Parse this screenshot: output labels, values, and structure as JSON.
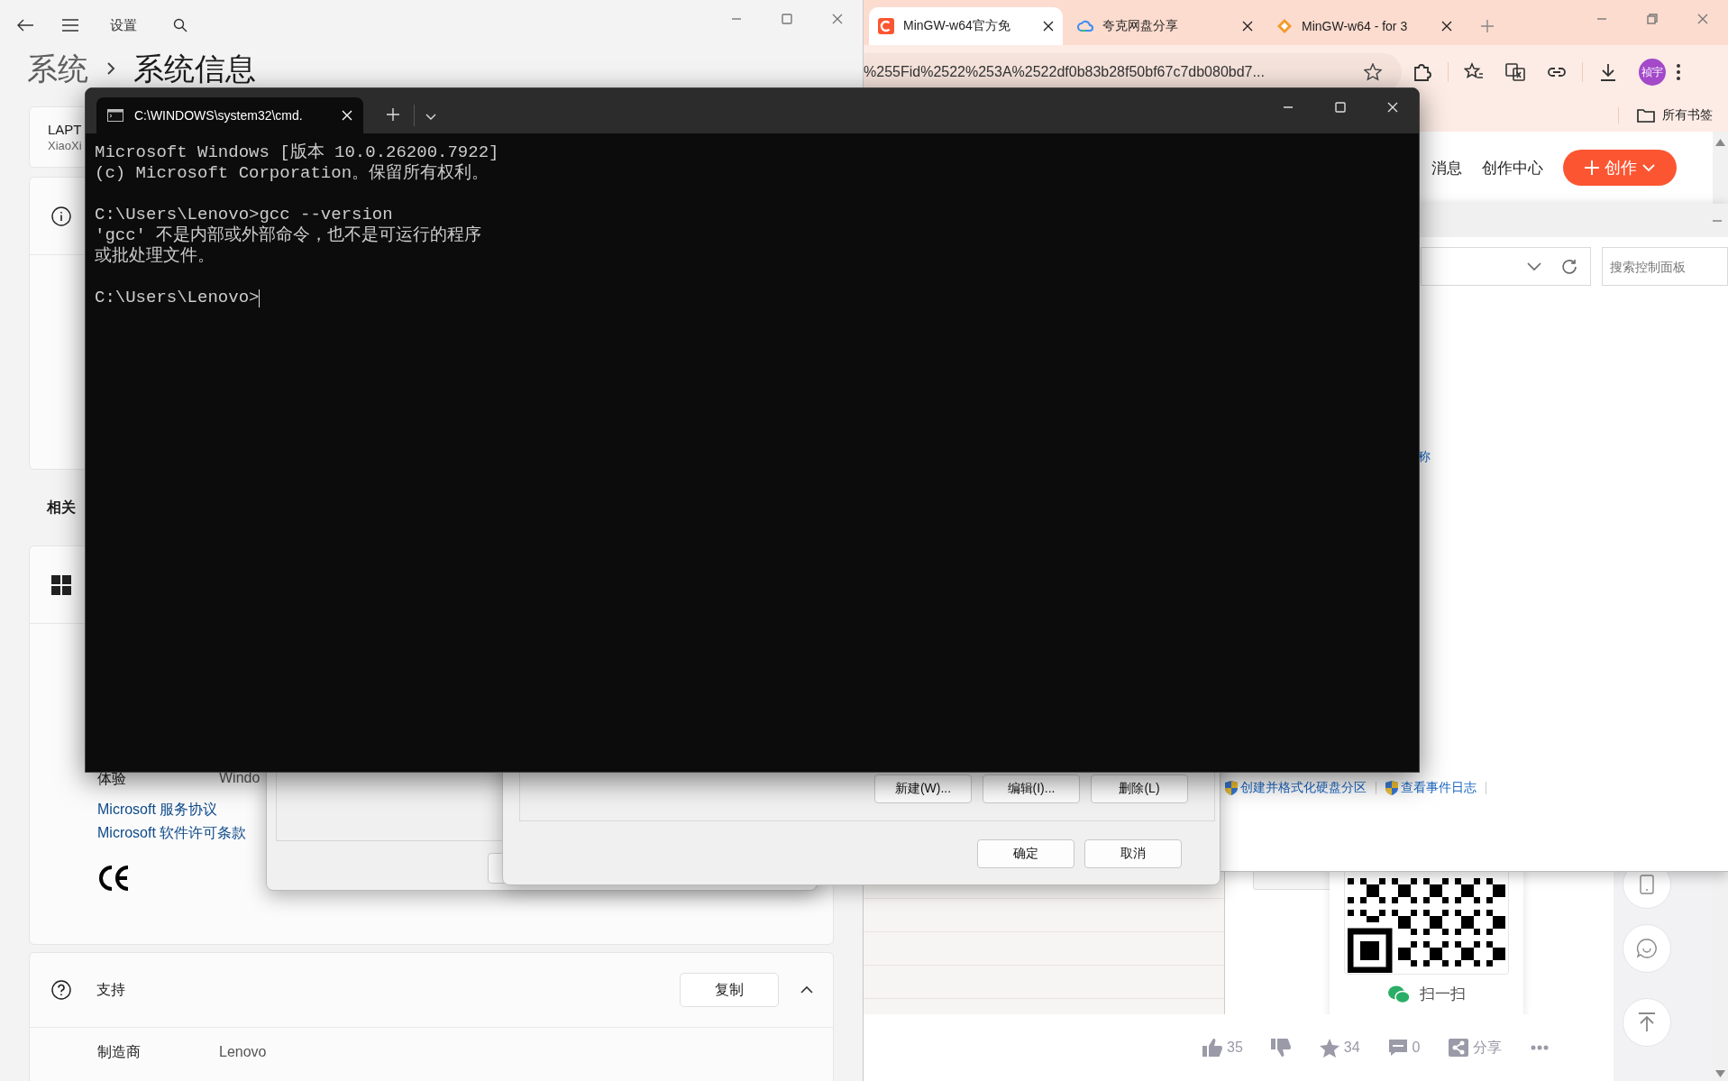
{
  "settings": {
    "title": "设置",
    "breadcrumb": {
      "parent": "系统",
      "current": "系统信息"
    },
    "device": {
      "name": "LAPT",
      "model": "XiaoXi"
    },
    "related_heading": "相关",
    "specs": [
      {
        "label": "体验",
        "value": "Windo"
      }
    ],
    "links": [
      "Microsoft 服务协议",
      "Microsoft 软件许可条款"
    ],
    "support": {
      "title": "支持",
      "copy_button": "复制",
      "expanded": true,
      "rows": [
        {
          "label": "制造商",
          "value": "Lenovo"
        }
      ]
    }
  },
  "browser": {
    "tabs": [
      {
        "title": "MinGW-w64官方免",
        "selected": true,
        "kind": "letter-c"
      },
      {
        "title": "夸克网盘分享",
        "selected": false,
        "kind": "cloud"
      },
      {
        "title": "MinGW-w64 - for 3",
        "selected": false,
        "kind": "diamond"
      }
    ],
    "url": "%255Fid%2522%253A%2522df0b83b28f50bf67c7db080bd7...",
    "avatar": "祯宇",
    "bookmarks": [
      "所有书签"
    ],
    "page": {
      "nav": [
        "消息",
        "创作中心"
      ],
      "create_button": "创作",
      "qr_caption": "扫一扫",
      "actions": [
        {
          "kind": "like",
          "label": "35"
        },
        {
          "kind": "dislike"
        },
        {
          "kind": "favorite",
          "label": "34"
        },
        {
          "kind": "comment",
          "label": "0"
        },
        {
          "kind": "share",
          "label": "分享"
        },
        {
          "kind": "more"
        }
      ]
    }
  },
  "control_panel": {
    "search": {
      "placeholder": "搜索控制面板"
    },
    "link_fragment": "称",
    "tasks": [
      "创建并格式化硬盘分区",
      "查看事件日志"
    ]
  },
  "dialog": {
    "list_buttons": [
      "新建(W)...",
      "编辑(I)...",
      "删除(L)"
    ],
    "buttons": [
      "确定",
      "取消"
    ]
  },
  "terminal": {
    "tab_title": "C:\\WINDOWS\\system32\\cmd.",
    "cursor_visible": true,
    "paragraphs": [
      [
        "Microsoft Windows [版本 10.0.26200.7922]",
        "(c) Microsoft Corporation。保留所有权利。"
      ],
      [
        "C:\\Users\\Lenovo>gcc --version",
        "'gcc' 不是内部或外部命令，也不是可运行的程序",
        "或批处理文件。"
      ],
      [
        "C:\\Users\\Lenovo>"
      ]
    ]
  }
}
